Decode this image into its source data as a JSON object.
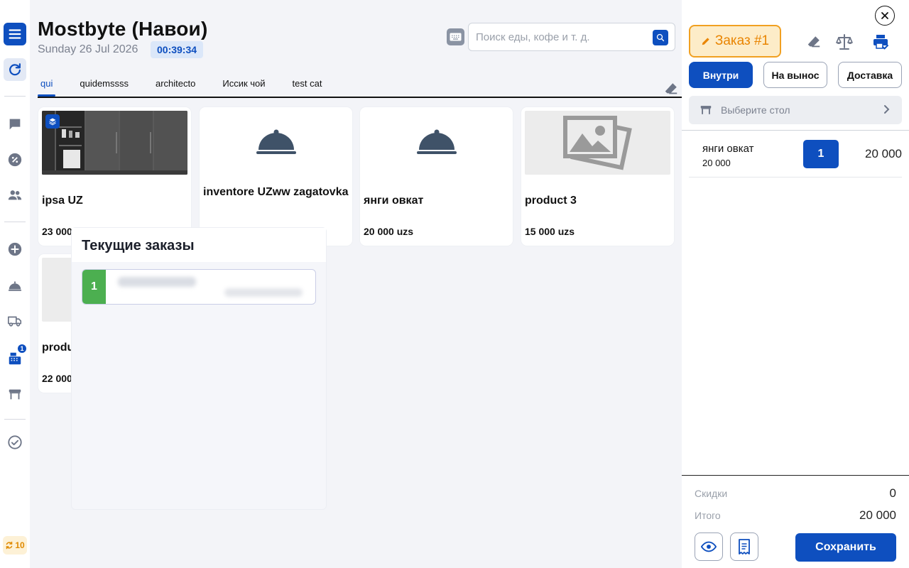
{
  "header": {
    "title": "Mostbyte (Навои)",
    "date": "Sunday 26 Jul 2026",
    "timer": "00:39:34"
  },
  "search": {
    "placeholder": "Поиск еды, кофе и т. д."
  },
  "tabs": [
    {
      "label": "qui",
      "active": true
    },
    {
      "label": "quidemssss"
    },
    {
      "label": "architecto"
    },
    {
      "label": "Иссик чой"
    },
    {
      "label": "test cat"
    }
  ],
  "products": [
    {
      "name": "ipsa UZ",
      "price": "23 000",
      "image": "wardrobe-photo"
    },
    {
      "name": "inventore UZww zagatovka",
      "price": "",
      "image": "cloche-icon"
    },
    {
      "name": "янги овкат",
      "price": "20 000 uzs",
      "image": "cloche-icon"
    },
    {
      "name": "product 3",
      "price": "15 000 uzs",
      "image": "image-placeholder-icon"
    },
    {
      "name": "produ",
      "price": "22 000",
      "image": "blank"
    }
  ],
  "rail": {
    "notification_count": "1",
    "sync_count": "10"
  },
  "current_orders": {
    "title": "Текущие заказы",
    "orders": [
      {
        "number": "1"
      }
    ]
  },
  "order_panel": {
    "order_label": "Заказ #1",
    "modes": [
      "Внутри",
      "На вынос",
      "Доставка"
    ],
    "active_mode": "Внутри",
    "table_placeholder": "Выберите стол",
    "items": [
      {
        "name": "янги овкат",
        "unit_price": "20 000",
        "qty": "1",
        "total": "20 000"
      }
    ],
    "discount_label": "Скидки",
    "discount_value": "0",
    "total_label": "Итого",
    "total_value": "20 000",
    "save_label": "Сохранить"
  },
  "colors": {
    "primary": "#0e4fbf",
    "accent": "#f1a021",
    "success": "#4caf50"
  }
}
